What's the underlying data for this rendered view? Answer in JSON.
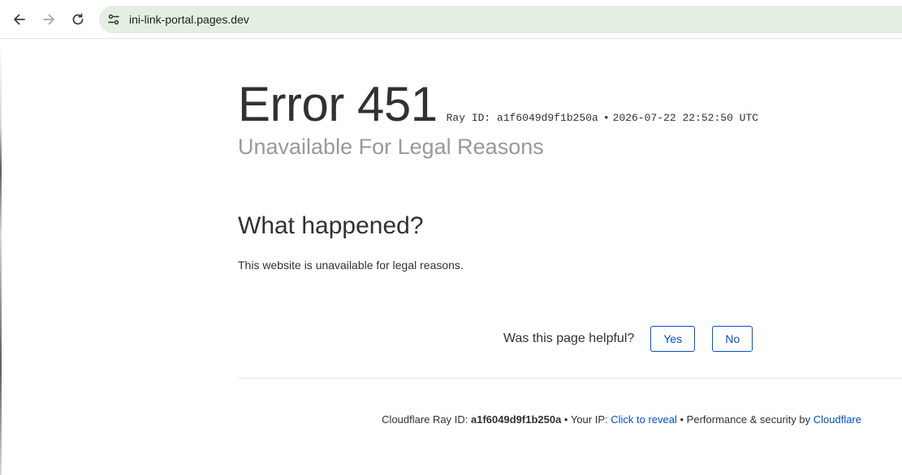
{
  "browser": {
    "url": "ini-link-portal.pages.dev"
  },
  "page": {
    "error_title": "Error 451",
    "ray_label": "Ray ID: a1f6049d9f1b250a",
    "ray_separator": "•",
    "timestamp": "2026-07-22 22:52:50 UTC",
    "subtitle": "Unavailable For Legal Reasons",
    "what_happened_title": "What happened?",
    "what_happened_body": "This website is unavailable for legal reasons."
  },
  "feedback": {
    "question": "Was this page helpful?",
    "yes_label": "Yes",
    "no_label": "No"
  },
  "footer": {
    "ray_prefix": "Cloudflare Ray ID: ",
    "ray_value": "a1f6049d9f1b250a",
    "sep1": " • Your IP: ",
    "reveal_link": "Click to reveal",
    "sep2": " • Performance & security by ",
    "cloudflare_link": "Cloudflare"
  },
  "colors": {
    "link": "#0051c3",
    "omnibox_bg": "#e4eee2",
    "subtitle": "#999999"
  }
}
